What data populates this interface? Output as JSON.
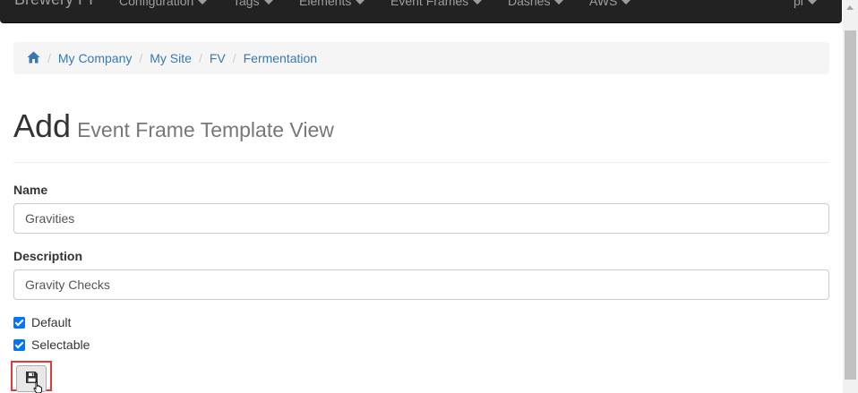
{
  "navbar": {
    "brand": "Brewery PI",
    "items": [
      {
        "label": "Configuration"
      },
      {
        "label": "Tags"
      },
      {
        "label": "Elements"
      },
      {
        "label": "Event Frames"
      },
      {
        "label": "Dashes"
      },
      {
        "label": "AWS"
      }
    ],
    "user": "pi"
  },
  "breadcrumb": {
    "home_icon": "home-icon",
    "items": [
      "My Company",
      "My Site",
      "FV",
      "Fermentation"
    ]
  },
  "header": {
    "title": "Add",
    "subtitle": "Event Frame Template View"
  },
  "form": {
    "name_label": "Name",
    "name_value": "Gravities",
    "description_label": "Description",
    "description_value": "Gravity Checks",
    "default_label": "Default",
    "default_checked": true,
    "selectable_label": "Selectable",
    "selectable_checked": true,
    "save_icon": "floppy-disk-icon"
  },
  "colors": {
    "navbar_bg": "#222222",
    "link": "#337ab7",
    "checkbox": "#0075ff",
    "highlight": "#e53935"
  }
}
